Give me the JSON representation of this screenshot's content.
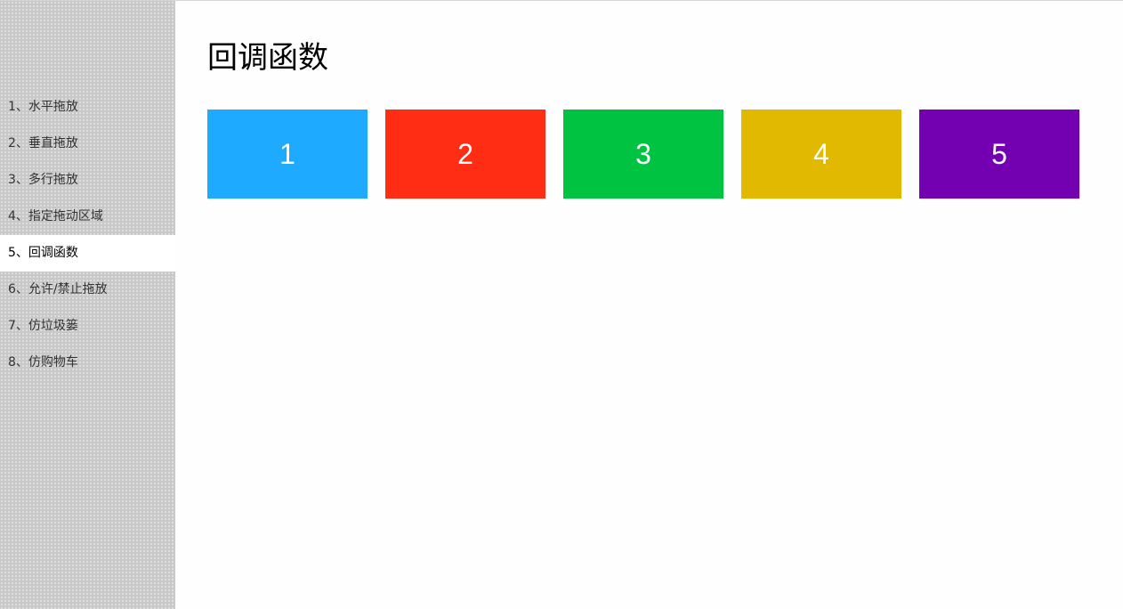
{
  "sidebar": {
    "items": [
      {
        "label": "1、水平拖放",
        "active": false
      },
      {
        "label": "2、垂直拖放",
        "active": false
      },
      {
        "label": "3、多行拖放",
        "active": false
      },
      {
        "label": "4、指定拖动区域",
        "active": false
      },
      {
        "label": "5、回调函数",
        "active": true
      },
      {
        "label": "6、允许/禁止拖放",
        "active": false
      },
      {
        "label": "7、仿垃圾篓",
        "active": false
      },
      {
        "label": "8、仿购物车",
        "active": false
      }
    ]
  },
  "main": {
    "title": "回调函数",
    "boxes": [
      {
        "label": "1",
        "color": "#1eaaff"
      },
      {
        "label": "2",
        "color": "#ff2d14"
      },
      {
        "label": "3",
        "color": "#00c341"
      },
      {
        "label": "4",
        "color": "#e1b900"
      },
      {
        "label": "5",
        "color": "#7300b1"
      }
    ]
  }
}
